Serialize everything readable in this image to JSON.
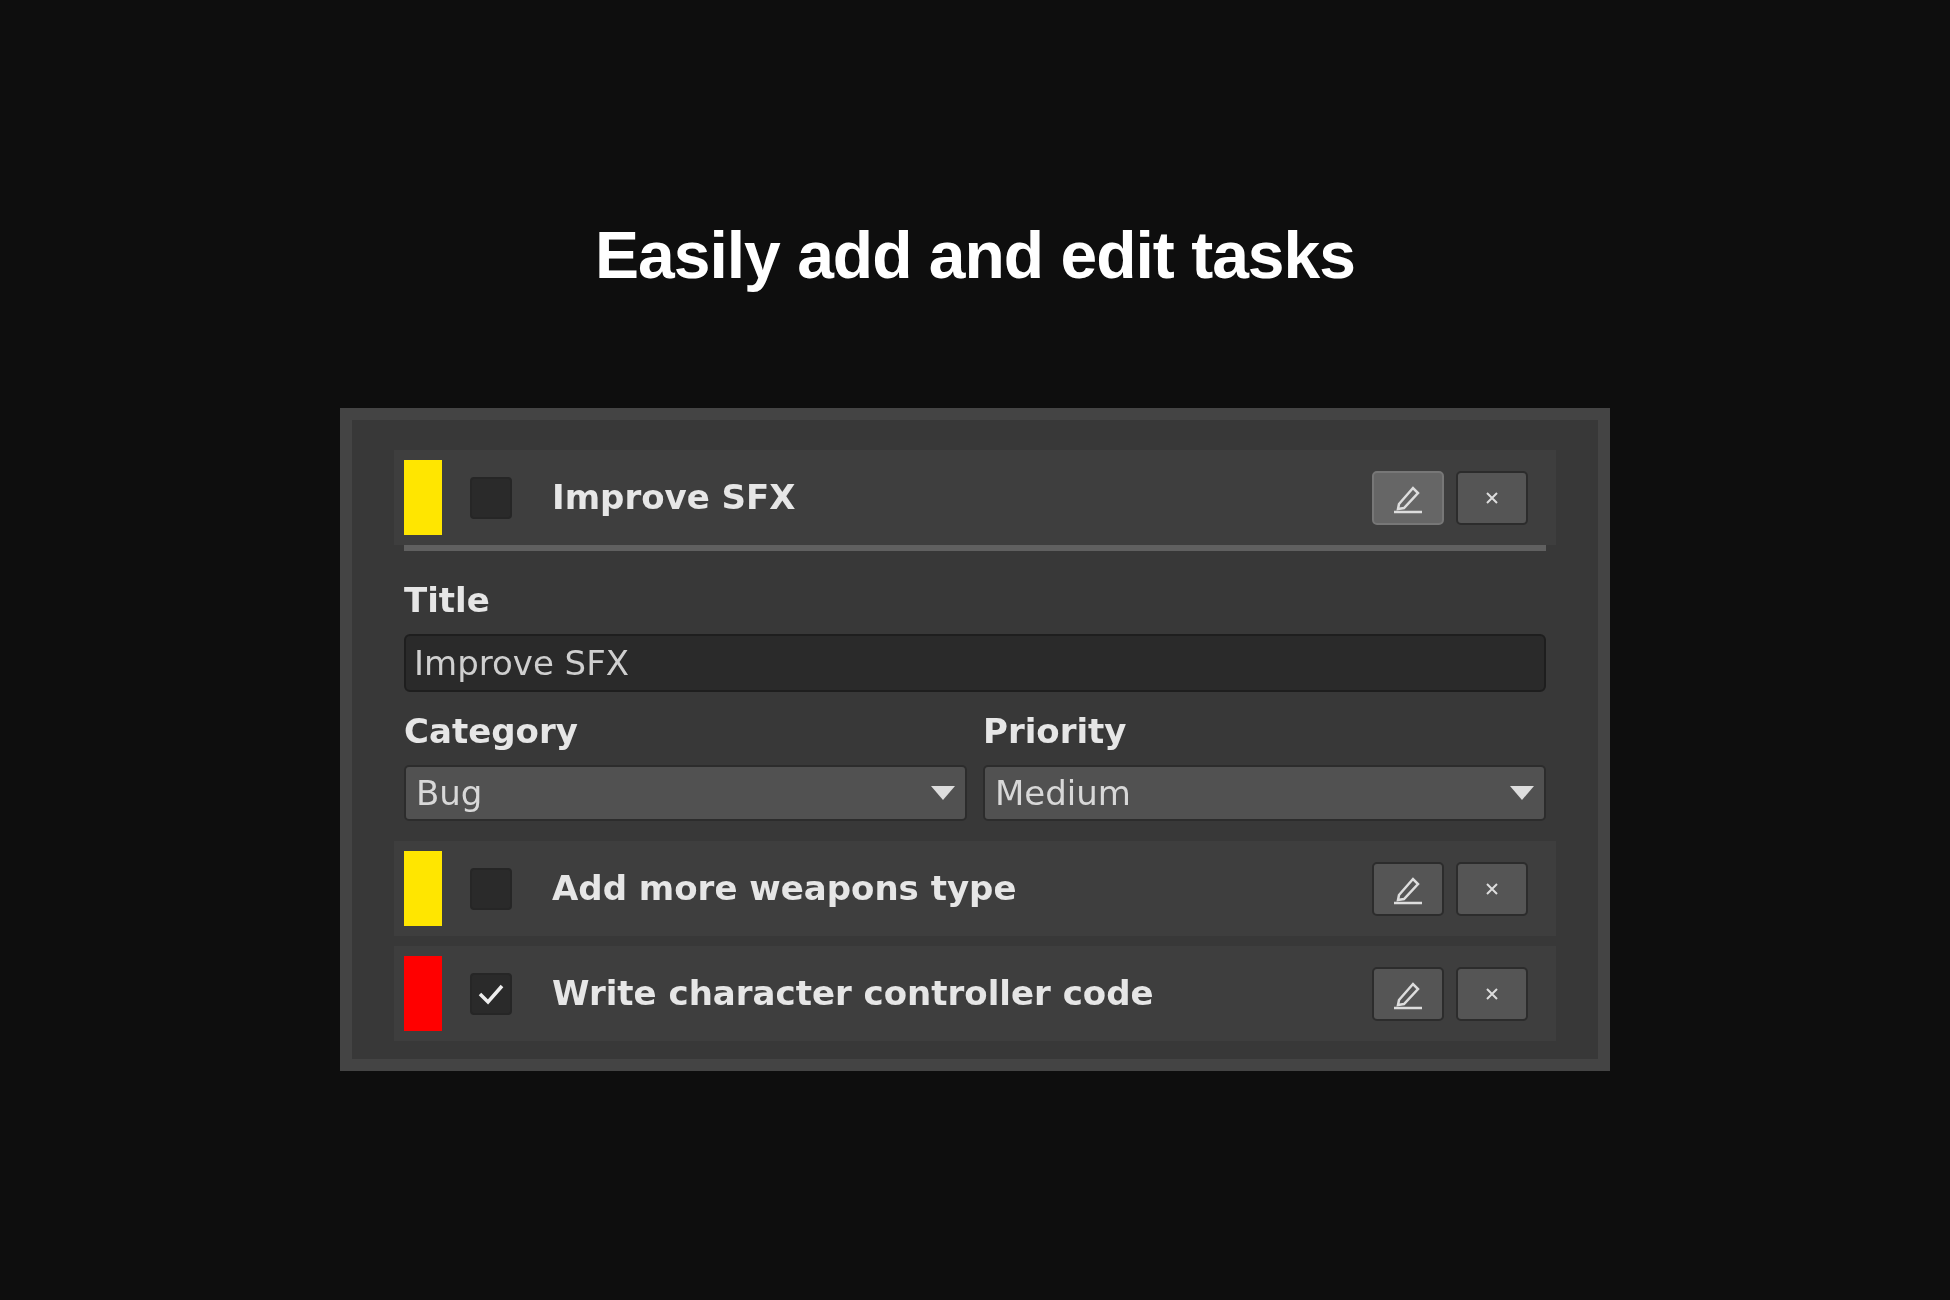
{
  "heading": "Easily add and edit tasks",
  "tasks": [
    {
      "title": "Improve SFX",
      "color": "#ffe600",
      "checked": false,
      "expanded": true,
      "editor": {
        "title_label": "Title",
        "title_value": "Improve SFX",
        "category_label": "Category",
        "category_value": "Bug",
        "priority_label": "Priority",
        "priority_value": "Medium"
      }
    },
    {
      "title": "Add more weapons type",
      "color": "#ffe600",
      "checked": false,
      "expanded": false
    },
    {
      "title": "Write character controller code",
      "color": "#ff0000",
      "checked": true,
      "expanded": false
    }
  ]
}
